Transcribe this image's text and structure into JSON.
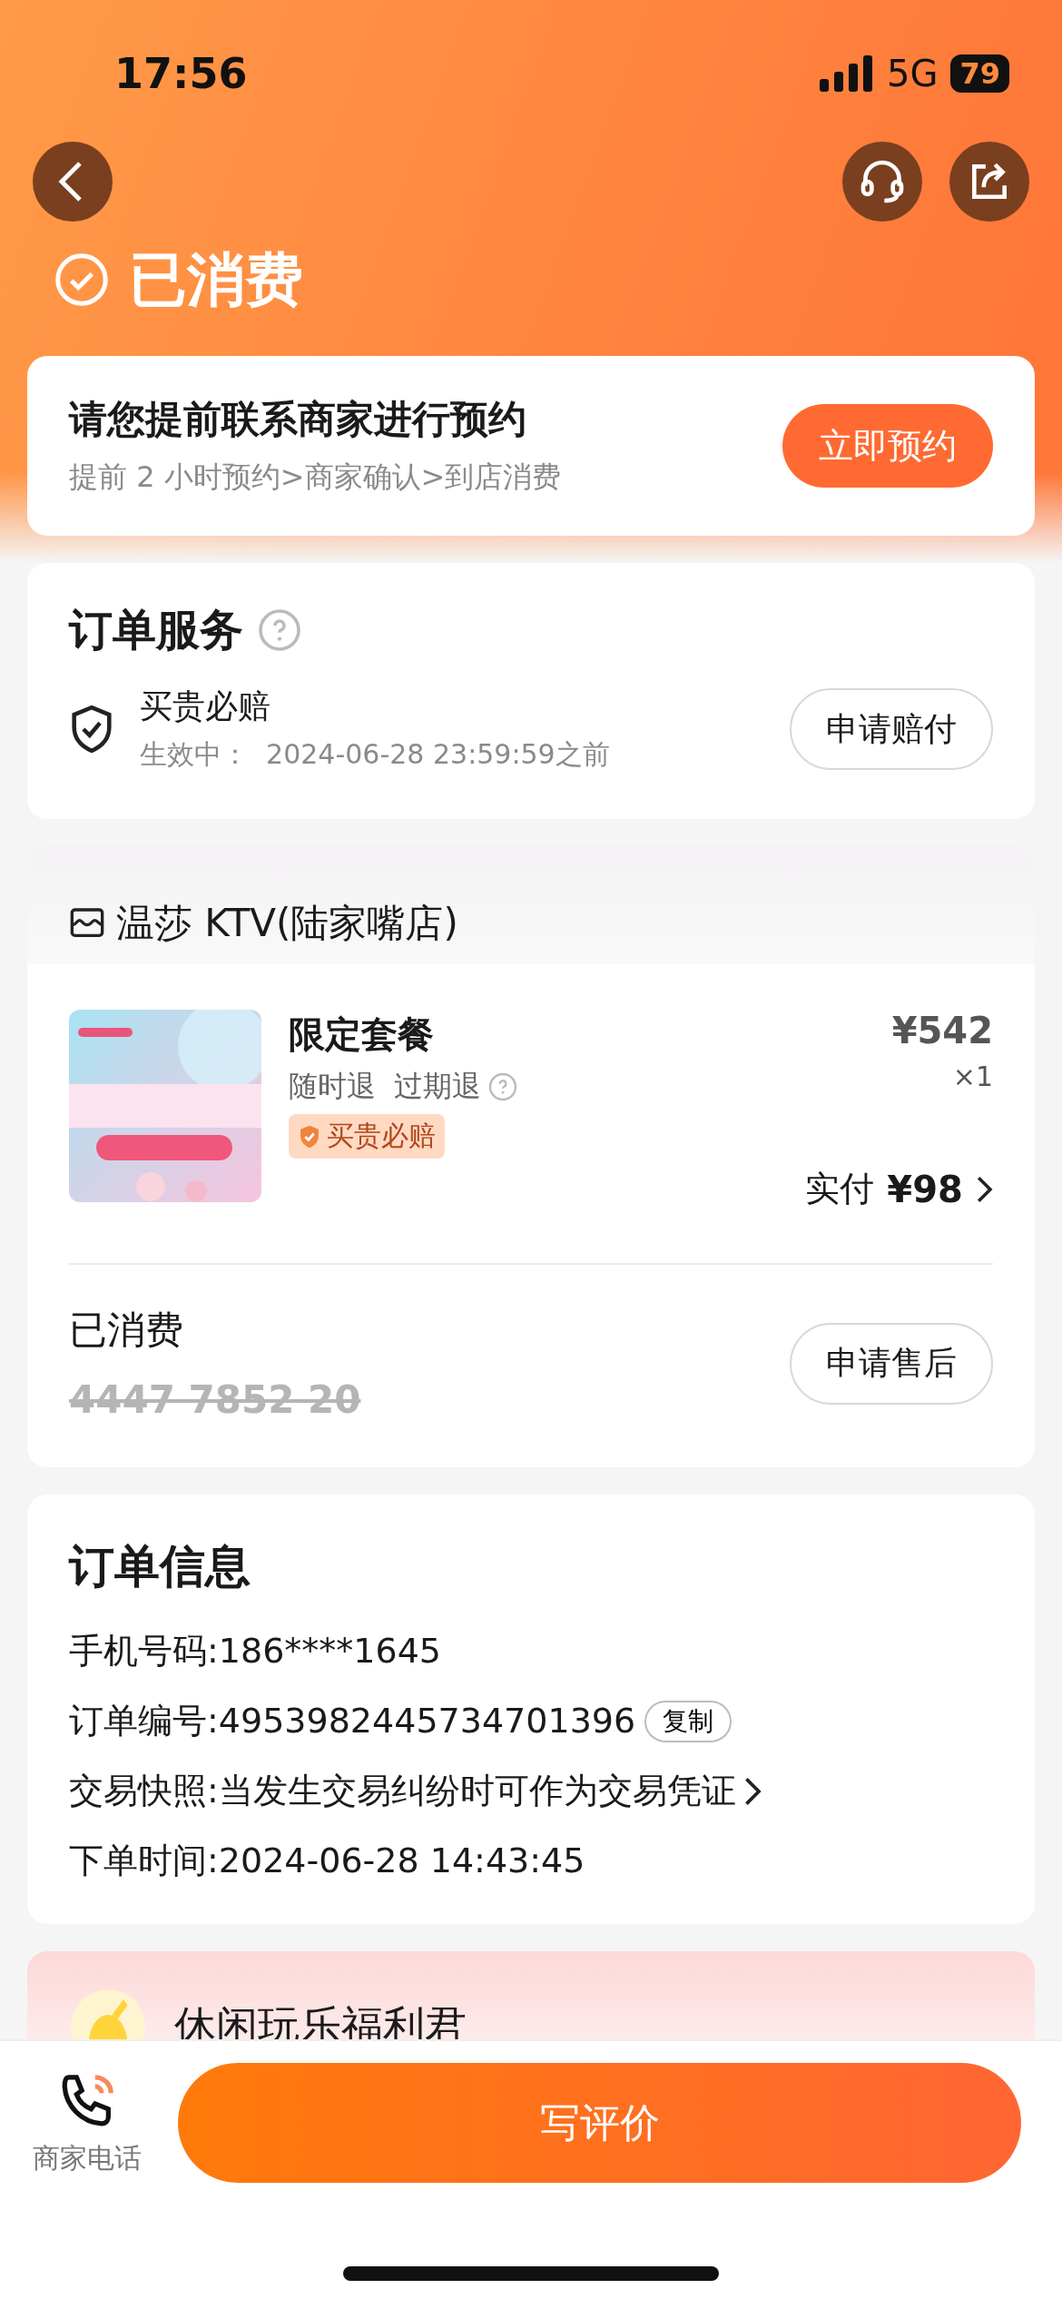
{
  "status_bar": {
    "time": "17:56",
    "network": "5G",
    "battery": "79"
  },
  "header": {
    "status": "已消费"
  },
  "reservation": {
    "title": "请您提前联系商家进行预约",
    "steps": "提前 2 小时预约>商家确认>到店消费",
    "button": "立即预约"
  },
  "order_service": {
    "title": "订单服务",
    "items": [
      {
        "name": "买贵必赔",
        "validity": "生效中：  2024-06-28 23:59:59之前",
        "button": "申请赔付"
      }
    ]
  },
  "shop": {
    "name": "温莎 KTV(陆家嘴店)",
    "product": {
      "kind": "picture",
      "name": "限定套餐",
      "terms": "随时退  过期退",
      "badge": "买贵必赔",
      "price": "¥542",
      "quantity": "×1",
      "paid_label": "实付",
      "paid_amount": "¥98"
    },
    "consumption": {
      "status": "已消费",
      "code": "4447 7852 20",
      "used": true,
      "button": "申请售后"
    }
  },
  "order_info": {
    "title": "订单信息",
    "rows": [
      {
        "kind": "text",
        "text": "手机号码:186****1645"
      },
      {
        "kind": "copy",
        "text": "订单编号:4953982445734701396",
        "action": "复制"
      },
      {
        "kind": "link",
        "text": "交易快照:当发生交易纠纷时可作为交易凭证"
      },
      {
        "kind": "text",
        "text": "下单时间:2024-06-28 14:43:45"
      }
    ]
  },
  "promo": {
    "title": "休闲玩乐福利君"
  },
  "bottom_bar": {
    "phone_label": "商家电话",
    "review_button": "写评价"
  }
}
